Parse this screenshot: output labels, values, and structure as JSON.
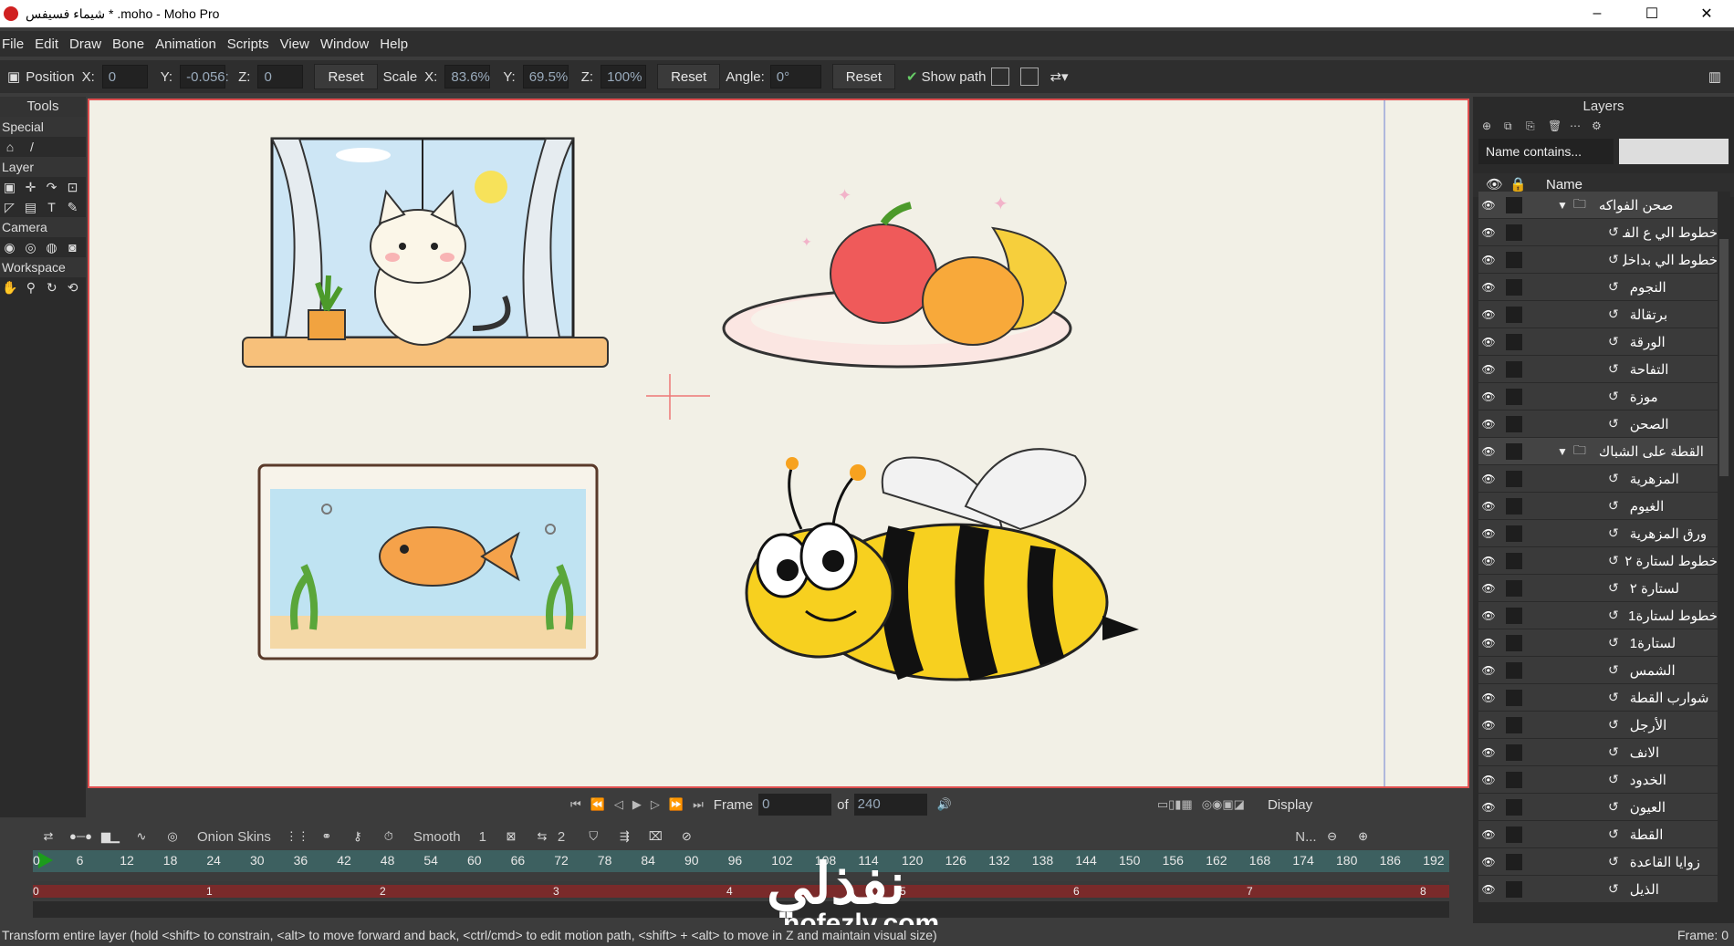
{
  "window": {
    "title": "شيماء فسيفس * .moho - Moho Pro",
    "minimize": "–",
    "maximize": "☐",
    "close": "✕"
  },
  "menu": [
    "File",
    "Edit",
    "Draw",
    "Bone",
    "Animation",
    "Scripts",
    "View",
    "Window",
    "Help"
  ],
  "options": {
    "position_label": "Position",
    "x_label": "X:",
    "x_value": "0",
    "y_label": "Y:",
    "y_value": "-0.056:",
    "z_label": "Z:",
    "z_value": "0",
    "reset1": "Reset",
    "scale_label": "Scale",
    "sx_label": "X:",
    "sx_value": "83.6%",
    "sy_label": "Y:",
    "sy_value": "69.5%",
    "sz_label": "Z:",
    "sz_value": "100%",
    "reset2": "Reset",
    "angle_label": "Angle:",
    "angle_value": "0°",
    "reset3": "Reset",
    "show_path": "Show path"
  },
  "tools": {
    "title": "Tools",
    "sections": [
      "Special",
      "Layer",
      "Camera",
      "Workspace"
    ]
  },
  "layers": {
    "title": "Layers",
    "filter": "Name contains...",
    "col_name": "Name",
    "items": [
      {
        "name": "صحن الفواكه",
        "group": true
      },
      {
        "name": "خطوط الي ع الفواكه",
        "group": false
      },
      {
        "name": "خطوط الي بداخل الصحن",
        "group": false
      },
      {
        "name": "النجوم",
        "group": false
      },
      {
        "name": "برتقالة",
        "group": false
      },
      {
        "name": "الورقة",
        "group": false
      },
      {
        "name": "التفاحة",
        "group": false
      },
      {
        "name": "موزة",
        "group": false
      },
      {
        "name": "الصحن",
        "group": false
      },
      {
        "name": "القطة على الشباك",
        "group": true
      },
      {
        "name": "المزهرية",
        "group": false
      },
      {
        "name": "الغيوم",
        "group": false
      },
      {
        "name": "ورق المزهرية",
        "group": false
      },
      {
        "name": "خطوط لستارة ٢",
        "group": false
      },
      {
        "name": "لستارة ٢",
        "group": false
      },
      {
        "name": "خطوط لستارة1",
        "group": false
      },
      {
        "name": "لستارة1",
        "group": false
      },
      {
        "name": "الشمس",
        "group": false
      },
      {
        "name": "شوارب القطة",
        "group": false
      },
      {
        "name": "الأرجل",
        "group": false
      },
      {
        "name": "الانف",
        "group": false
      },
      {
        "name": "الخدود",
        "group": false
      },
      {
        "name": "العيون",
        "group": false
      },
      {
        "name": "القطة",
        "group": false
      },
      {
        "name": "زوايا القاعدة",
        "group": false
      },
      {
        "name": "الذيل",
        "group": false
      }
    ]
  },
  "playback": {
    "frame_label": "Frame",
    "frame_value": "0",
    "of_label": "of",
    "of_value": "240",
    "display": "Display"
  },
  "timeline": {
    "onion": "Onion Skins",
    "smooth": "Smooth",
    "count": "1",
    "two": "2",
    "n_label": "N...",
    "ruler": [
      "0",
      "6",
      "12",
      "18",
      "24",
      "30",
      "36",
      "42",
      "48",
      "54",
      "60",
      "66",
      "72",
      "78",
      "84",
      "90",
      "96",
      "102",
      "108",
      "114",
      "120",
      "126",
      "132",
      "138",
      "144",
      "150",
      "156",
      "162",
      "168",
      "174",
      "180",
      "186",
      "192"
    ],
    "track": [
      "0",
      "1",
      "2",
      "3",
      "4",
      "5",
      "6",
      "7",
      "8"
    ]
  },
  "status": {
    "text": "Transform entire layer (hold <shift> to constrain, <alt> to move forward and back, <ctrl/cmd> to edit motion path, <shift> + <alt> to move in Z and maintain visual size)",
    "frame": "Frame: 0"
  },
  "watermark": {
    "main": "نفذلي",
    "sub": "nofezly.com"
  }
}
